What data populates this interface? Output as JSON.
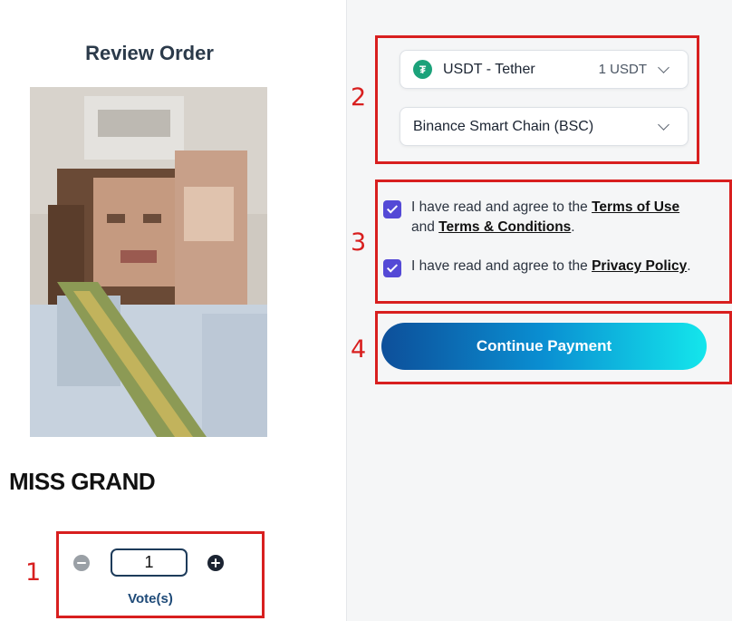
{
  "left_panel": {
    "title": "Review Order",
    "contestant_name": "MISS GRAND",
    "vote_stepper": {
      "value": "1",
      "label": "Vote(s)"
    }
  },
  "payment": {
    "currency": {
      "icon": "tether-icon",
      "label": "USDT - Tether",
      "amount": "1 USDT"
    },
    "network": {
      "label": "Binance Smart Chain (BSC)"
    }
  },
  "agreements": {
    "terms": {
      "prefix": "I have read and agree to the ",
      "link1": "Terms of Use",
      "middle": " and ",
      "link2": "Terms & Conditions",
      "suffix": ".",
      "checked": true
    },
    "privacy": {
      "prefix": "I have read and agree to the ",
      "link": "Privacy Policy",
      "suffix": ".",
      "checked": true
    }
  },
  "continue_button": {
    "label": "Continue Payment"
  },
  "annotations": [
    "1",
    "2",
    "3",
    "4"
  ],
  "colors": {
    "annotation_red": "#d81f1f",
    "checkbox_purple": "#5449d6",
    "tether_green": "#1ba27a",
    "button_gradient_start": "#0d4f9a",
    "button_gradient_end": "#14e6ec"
  }
}
